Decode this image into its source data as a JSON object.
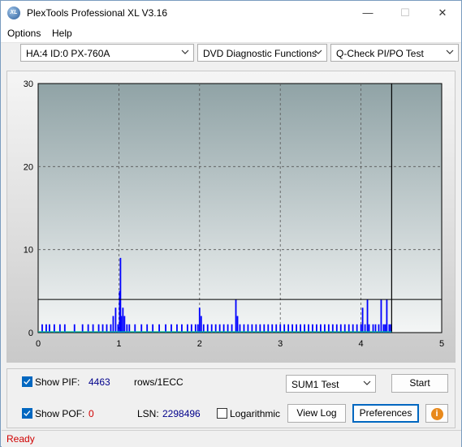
{
  "window": {
    "title": "PlexTools Professional XL V3.16",
    "icon_text": "XL",
    "min": "—",
    "max": "☐",
    "close": "✕"
  },
  "menu": {
    "options": "Options",
    "help": "Help"
  },
  "toolbar": {
    "drive": "HA:4 ID:0  PX-760A",
    "function": "DVD Diagnostic Functions",
    "test": "Q-Check PI/PO Test"
  },
  "chart_data": {
    "type": "bar",
    "title": "",
    "xlabel": "",
    "ylabel": "",
    "xlim": [
      0,
      5
    ],
    "ylim": [
      0,
      30
    ],
    "x_ticks": [
      "0",
      "1",
      "2",
      "3",
      "4",
      "5"
    ],
    "y_ticks": [
      "0",
      "10",
      "20",
      "30"
    ],
    "threshold": 4,
    "end_marker_x": 4.38,
    "grid": true,
    "series": [
      {
        "color": "#0000ff",
        "x": [
          0.05,
          0.1,
          0.14,
          0.2,
          0.27,
          0.33,
          0.45,
          0.55,
          0.62,
          0.68,
          0.75,
          0.8,
          0.85,
          0.9,
          0.93,
          0.96,
          0.99,
          1.01,
          1.02,
          1.03,
          1.05,
          1.07,
          1.1,
          1.13,
          1.2,
          1.28,
          1.35,
          1.42,
          1.5,
          1.58,
          1.65,
          1.72,
          1.78,
          1.85,
          1.9,
          1.95,
          1.98,
          2.0,
          2.02,
          2.05,
          2.1,
          2.15,
          2.2,
          2.25,
          2.3,
          2.35,
          2.4,
          2.45,
          2.47,
          2.5,
          2.55,
          2.6,
          2.65,
          2.7,
          2.75,
          2.8,
          2.85,
          2.9,
          2.95,
          3.0,
          3.05,
          3.1,
          3.15,
          3.2,
          3.25,
          3.3,
          3.35,
          3.4,
          3.45,
          3.5,
          3.55,
          3.6,
          3.65,
          3.7,
          3.75,
          3.8,
          3.85,
          3.9,
          3.95,
          4.0,
          4.02,
          4.05,
          4.08,
          4.1,
          4.15,
          4.18,
          4.22,
          4.25,
          4.28,
          4.3,
          4.32,
          4.35,
          4.37
        ],
        "values": [
          1,
          1,
          1,
          1,
          1,
          1,
          1,
          1,
          1,
          1,
          1,
          1,
          1,
          1,
          2,
          3,
          1,
          5,
          9,
          2,
          3,
          2,
          1,
          1,
          1,
          1,
          1,
          1,
          1,
          1,
          1,
          1,
          1,
          1,
          1,
          1,
          1,
          3,
          2,
          1,
          1,
          1,
          1,
          1,
          1,
          1,
          1,
          4,
          2,
          1,
          1,
          1,
          1,
          1,
          1,
          1,
          1,
          1,
          1,
          1,
          1,
          1,
          1,
          1,
          1,
          1,
          1,
          1,
          1,
          1,
          1,
          1,
          1,
          1,
          1,
          1,
          1,
          1,
          1,
          1,
          3,
          1,
          4,
          1,
          1,
          1,
          1,
          4,
          1,
          1,
          4,
          1,
          1
        ]
      }
    ]
  },
  "bottom": {
    "show_pif_label": "Show PIF:",
    "pif_value": "4463",
    "pif_unit": "rows/1ECC",
    "show_pof_label": "Show POF:",
    "pof_value": "0",
    "lsn_label": "LSN:",
    "lsn_value": "2298496",
    "logarithmic_label": "Logarithmic",
    "sum_select": "SUM1 Test",
    "start_label": "Start",
    "view_log_label": "View Log",
    "preferences_label": "Preferences",
    "info_icon_text": "i"
  },
  "status": {
    "text": "Ready"
  },
  "colors": {
    "accent": "#0067c0",
    "status": "#d00000",
    "bars": "#0000ff",
    "value_blue": "#00008b",
    "value_red": "#d00000"
  }
}
